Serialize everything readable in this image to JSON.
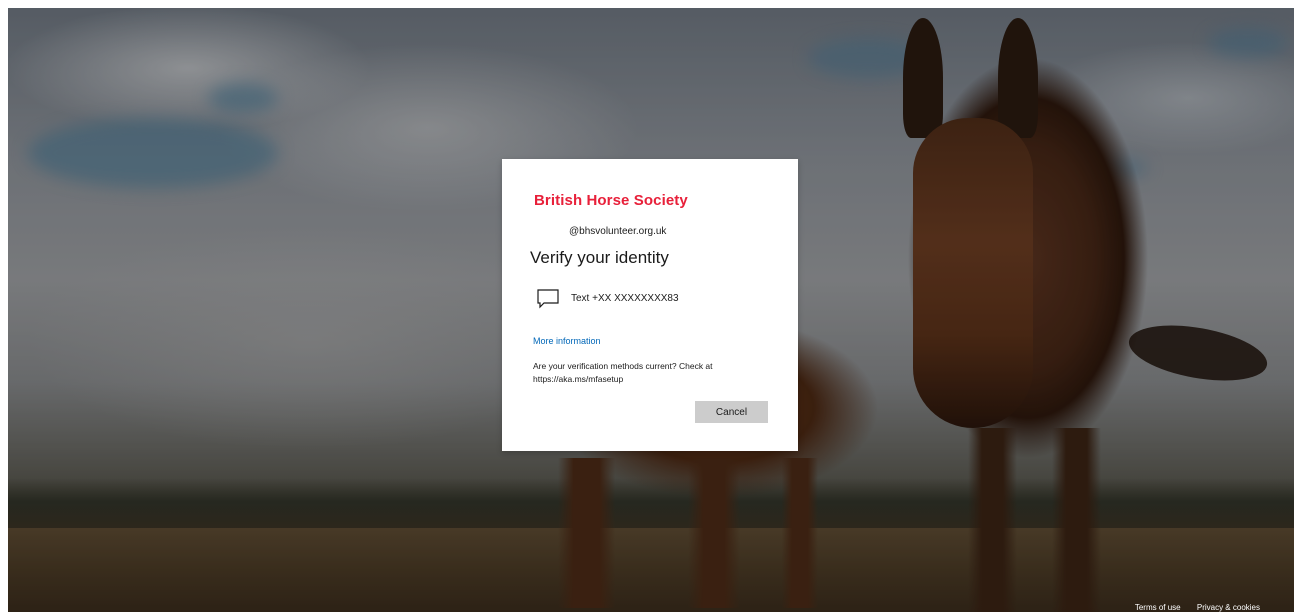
{
  "brand": {
    "logo_text": "British Horse Society",
    "logo_color": "#e8203a"
  },
  "dialog": {
    "account": "@bhsvolunteer.org.uk",
    "title": "Verify your identity",
    "methods": [
      {
        "icon": "message-icon",
        "label": "Text +XX XXXXXXXX83"
      }
    ],
    "more_info_link": "More information",
    "note_line1": "Are your verification methods current? Check at",
    "note_line2": "https://aka.ms/mfasetup",
    "cancel_label": "Cancel",
    "link_color": "#0067b8",
    "button_color": "#cccccc"
  },
  "footer": {
    "terms": "Terms of use",
    "privacy": "Privacy & cookies"
  }
}
